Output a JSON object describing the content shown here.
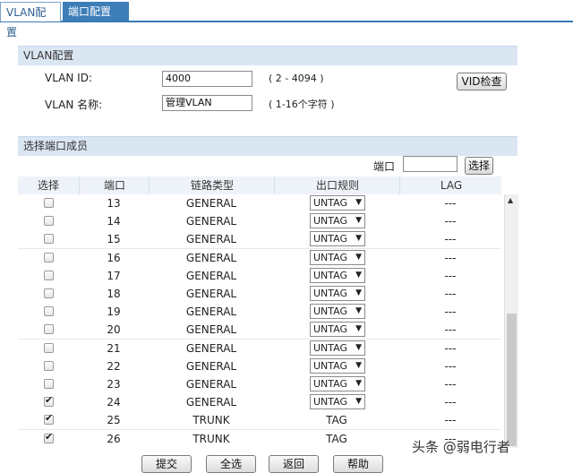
{
  "tabs": [
    {
      "label": "VLAN配置",
      "active": true
    },
    {
      "label": "端口配置",
      "active": false
    }
  ],
  "vlan_config": {
    "title": "VLAN配置",
    "vlan_id_label": "VLAN ID:",
    "vlan_id_value": "4000",
    "vlan_id_hint": "( 2 - 4094 )",
    "vlan_name_label": "VLAN 名称:",
    "vlan_name_value": "管理VLAN",
    "vlan_name_hint": "( 1-16个字符 )",
    "vid_check_button": "VID检查"
  },
  "members": {
    "title": "选择端口成员",
    "port_search_label": "端口",
    "port_search_value": "",
    "select_button": "选择",
    "columns": [
      "选择",
      "端口",
      "链路类型",
      "出口规则",
      "LAG"
    ],
    "rows": [
      {
        "checked": false,
        "port": "13",
        "type": "GENERAL",
        "egress": "UNTAG",
        "dropdown": true,
        "lag": "---"
      },
      {
        "checked": false,
        "port": "14",
        "type": "GENERAL",
        "egress": "UNTAG",
        "dropdown": true,
        "lag": "---"
      },
      {
        "checked": false,
        "port": "15",
        "type": "GENERAL",
        "egress": "UNTAG",
        "dropdown": true,
        "lag": "---"
      },
      {
        "checked": false,
        "port": "16",
        "type": "GENERAL",
        "egress": "UNTAG",
        "dropdown": true,
        "lag": "---"
      },
      {
        "checked": false,
        "port": "17",
        "type": "GENERAL",
        "egress": "UNTAG",
        "dropdown": true,
        "lag": "---"
      },
      {
        "checked": false,
        "port": "18",
        "type": "GENERAL",
        "egress": "UNTAG",
        "dropdown": true,
        "lag": "---"
      },
      {
        "checked": false,
        "port": "19",
        "type": "GENERAL",
        "egress": "UNTAG",
        "dropdown": true,
        "lag": "---"
      },
      {
        "checked": false,
        "port": "20",
        "type": "GENERAL",
        "egress": "UNTAG",
        "dropdown": true,
        "lag": "---"
      },
      {
        "checked": false,
        "port": "21",
        "type": "GENERAL",
        "egress": "UNTAG",
        "dropdown": true,
        "lag": "---"
      },
      {
        "checked": false,
        "port": "22",
        "type": "GENERAL",
        "egress": "UNTAG",
        "dropdown": true,
        "lag": "---"
      },
      {
        "checked": false,
        "port": "23",
        "type": "GENERAL",
        "egress": "UNTAG",
        "dropdown": true,
        "lag": "---"
      },
      {
        "checked": true,
        "port": "24",
        "type": "GENERAL",
        "egress": "UNTAG",
        "dropdown": true,
        "lag": "---"
      },
      {
        "checked": true,
        "port": "25",
        "type": "TRUNK",
        "egress": "TAG",
        "dropdown": false,
        "lag": "---"
      },
      {
        "checked": true,
        "port": "26",
        "type": "TRUNK",
        "egress": "TAG",
        "dropdown": false,
        "lag": "---"
      }
    ]
  },
  "footer_buttons": [
    "提交",
    "全选",
    "返回",
    "帮助"
  ],
  "watermark": "头条 @弱电行者",
  "icons": {
    "dropdown": "▼",
    "scroll_up": "▲",
    "checkmark": "✔"
  },
  "colors": {
    "tab_active_text": "#2c5f8f",
    "tab_inactive_bg": "#3d7db8",
    "section_header_bg": "#dbe6f3"
  }
}
